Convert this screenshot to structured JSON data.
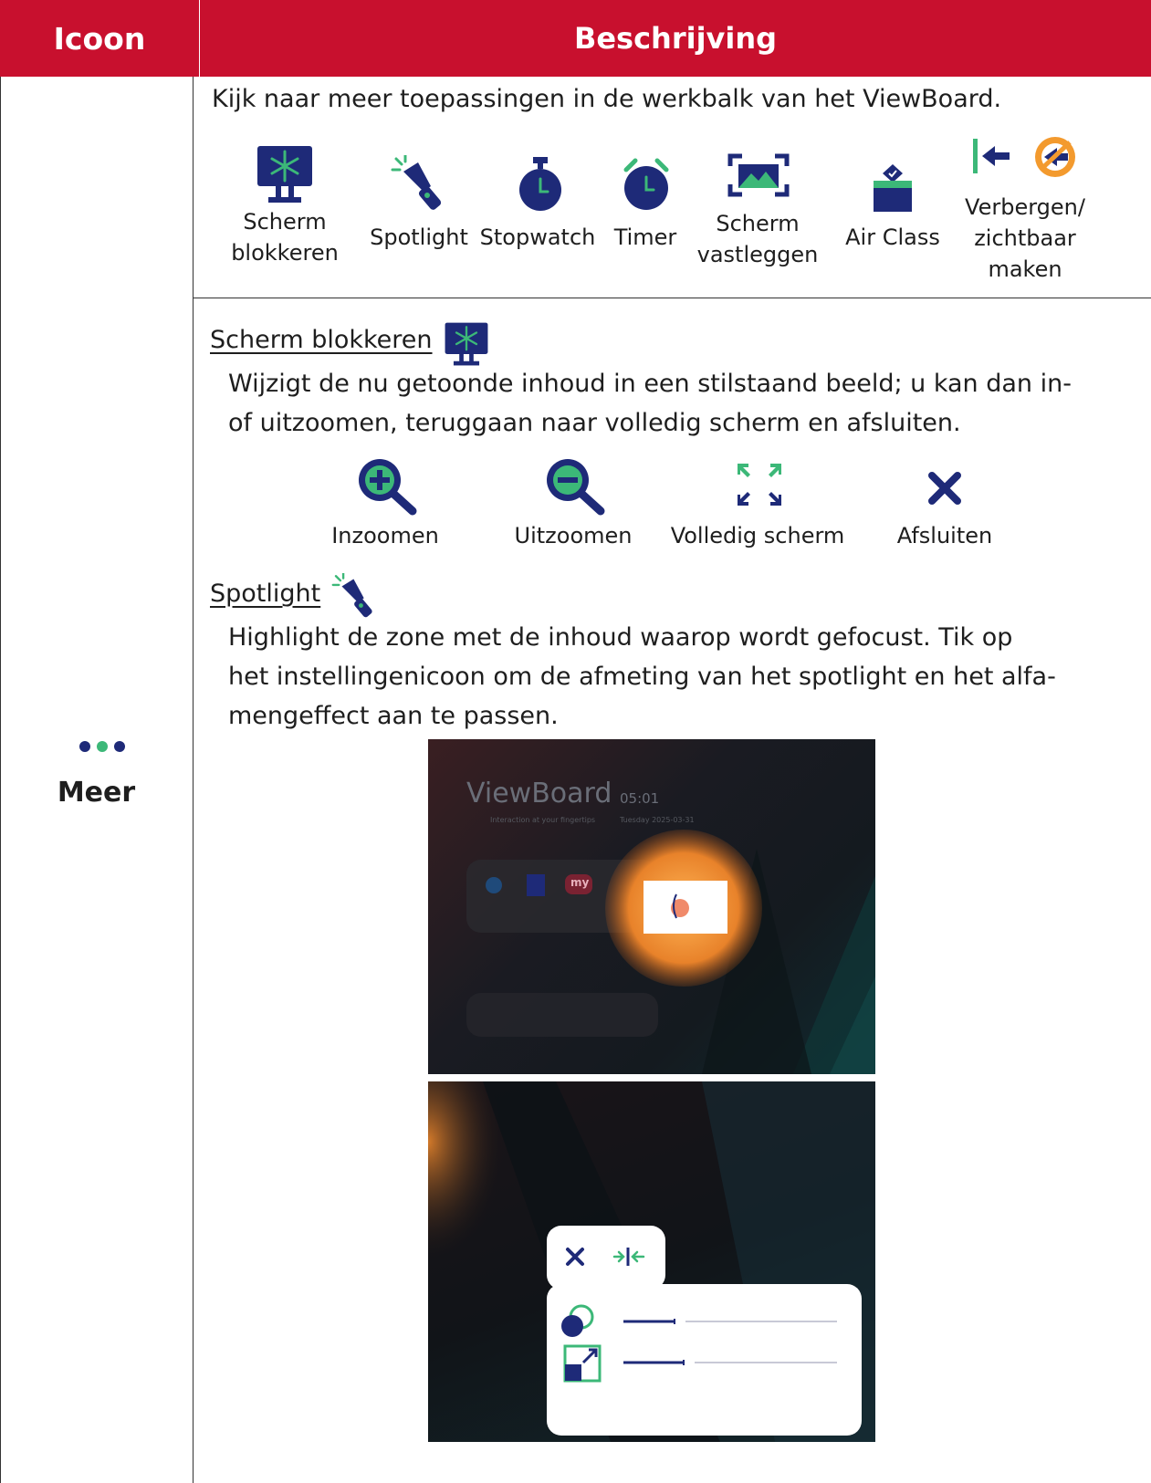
{
  "header": {
    "col_icon": "Icoon",
    "col_desc": "Beschrijving"
  },
  "row": {
    "icon_label": "Meer"
  },
  "intro": "Kijk naar meer toepassingen in de werkbalk van het ViewBoard.",
  "toolbar_items": [
    {
      "icon": "freeze-screen-icon",
      "label_1": "Scherm",
      "label_2": "blokkeren"
    },
    {
      "icon": "spotlight-icon",
      "label_1": "Spotlight"
    },
    {
      "icon": "stopwatch-icon",
      "label_1": "Stopwatch"
    },
    {
      "icon": "timer-icon",
      "label_1": "Timer"
    },
    {
      "icon": "screen-capture-icon",
      "label_1": "Scherm",
      "label_2": "vastleggen"
    },
    {
      "icon": "air-class-icon",
      "label_1": "Air Class"
    },
    {
      "icon": "hide-show-icon",
      "label_1": "Verbergen/",
      "label_2": "zichtbaar",
      "label_3": "maken"
    }
  ],
  "freeze": {
    "title": "Scherm blokkeren",
    "desc_1": "Wijzigt de nu getoonde inhoud in een stilstaand beeld; u kan dan in-",
    "desc_2": "of uitzoomen, teruggaan naar volledig scherm en afsluiten.",
    "actions": [
      "Inzoomen",
      "Uitzoomen",
      "Volledig scherm",
      "Afsluiten"
    ]
  },
  "spotlight": {
    "title": "Spotlight",
    "desc_1": "Highlight de zone met de inhoud waarop wordt gefocust. Tik op",
    "desc_2": "het instellingenicoon om de afmeting van het spotlight en het alfa-",
    "desc_3": "mengeffect aan te passen."
  },
  "screenshot_1": {
    "brand": "ViewBoard",
    "time": "05:01",
    "tagline": "Interaction at your fingertips",
    "date": "Tuesday 2025-03-31",
    "app_label": "my"
  },
  "colors": {
    "header": "#c8102e",
    "navy": "#1e2a78",
    "green": "#3cb878",
    "orange": "#f39a2e"
  }
}
